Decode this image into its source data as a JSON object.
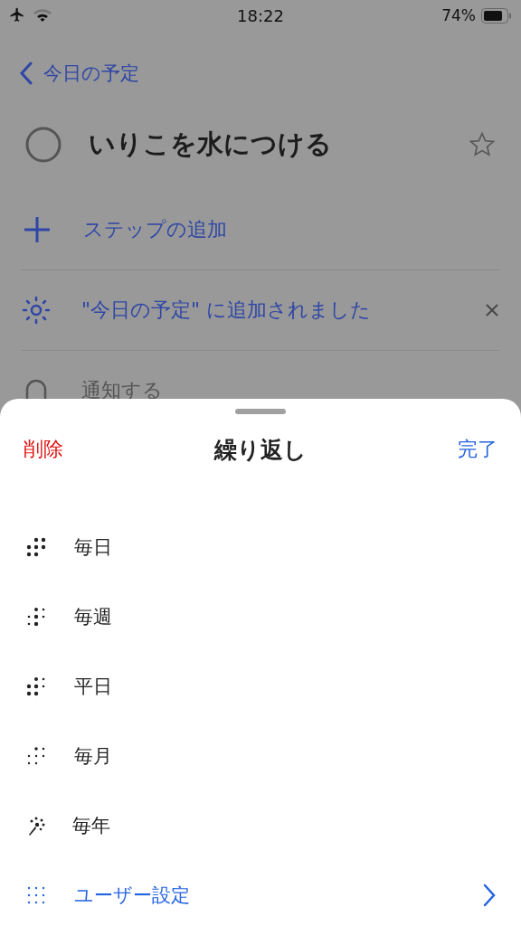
{
  "status_bar": {
    "time": "18:22",
    "battery": "74%"
  },
  "nav": {
    "back": "今日の予定"
  },
  "task": {
    "title": "いりこを水につける",
    "completed": false,
    "starred": false
  },
  "add_step": {
    "label": "ステップの追加"
  },
  "my_day": {
    "label": "\"今日の予定\" に追加されました"
  },
  "reminder": {
    "label": "通知する"
  },
  "sheet": {
    "title": "繰り返し",
    "delete": "削除",
    "done": "完了",
    "options": [
      {
        "label": "毎日",
        "kind": "daily"
      },
      {
        "label": "毎週",
        "kind": "weekly"
      },
      {
        "label": "平日",
        "kind": "weekdays"
      },
      {
        "label": "毎月",
        "kind": "monthly"
      },
      {
        "label": "毎年",
        "kind": "yearly"
      },
      {
        "label": "ユーザー設定",
        "kind": "custom"
      }
    ]
  }
}
